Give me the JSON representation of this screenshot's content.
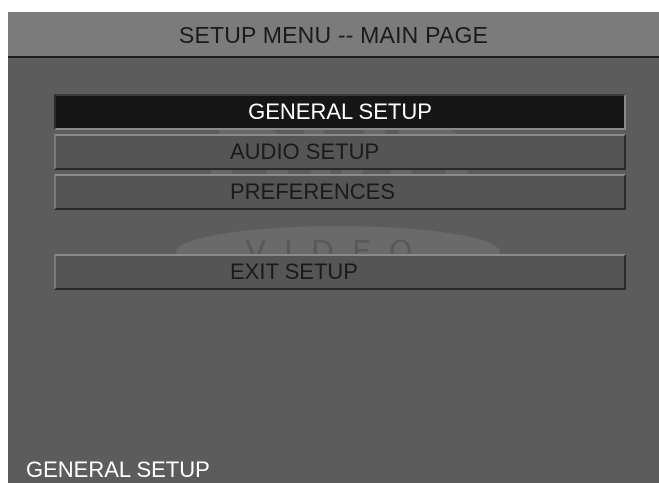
{
  "header": {
    "title": "SETUP MENU -- MAIN PAGE"
  },
  "menu": {
    "items": [
      {
        "label": "GENERAL SETUP",
        "selected": true
      },
      {
        "label": "AUDIO SETUP",
        "selected": false
      },
      {
        "label": "PREFERENCES",
        "selected": false
      },
      {
        "label": "EXIT SETUP",
        "selected": false
      }
    ]
  },
  "watermark": {
    "logo_text": "DVD",
    "sub_text": "VIDEO",
    "trademark": "™"
  },
  "status": {
    "text": "GENERAL SETUP"
  },
  "colors": {
    "screen_bg": "#5c5c5c",
    "title_bg": "#7b7b7b",
    "selected_bg": "#161616",
    "item_bg": "#555555"
  }
}
